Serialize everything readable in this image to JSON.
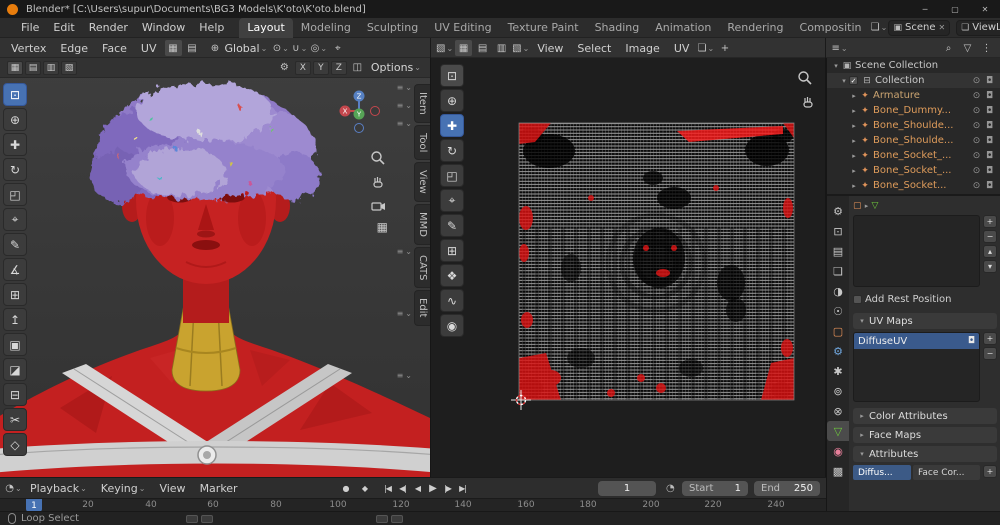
{
  "colors": {
    "accent": "#4772b3",
    "object_orange": "#e0935a",
    "data_green": "#6ec93c"
  },
  "titlebar": {
    "title": "Blender* [C:\\Users\\supur\\Documents\\BG3 Models\\K'oto\\K'oto.blend]"
  },
  "menubar": {
    "menus": [
      "File",
      "Edit",
      "Render",
      "Window",
      "Help"
    ],
    "workspaces": [
      "Layout",
      "Modeling",
      "Sculpting",
      "UV Editing",
      "Texture Paint",
      "Shading",
      "Animation",
      "Rendering",
      "Compositin"
    ],
    "scene_label": "Scene",
    "viewlayer_label": "ViewLayer"
  },
  "header3d": {
    "menus": [
      "Vertex",
      "Edge",
      "Face",
      "UV"
    ],
    "orientation": "Global",
    "mirror": [
      "X",
      "Y",
      "Z"
    ],
    "options_label": "Options"
  },
  "uv_header": {
    "menus": [
      "View",
      "Select",
      "Image",
      "UV"
    ]
  },
  "sidebar_tabs": [
    "Item",
    "Tool",
    "View",
    "MMD",
    "CATS",
    "Edit"
  ],
  "outliner": {
    "scene_collection": "Scene Collection",
    "collection": "Collection",
    "items": [
      "Armature",
      "Bone_Dummy...",
      "Bone_Shoulde...",
      "Bone_Shoulde...",
      "Bone_Socket_...",
      "Bone_Socket_...",
      "Bone_Socket..."
    ]
  },
  "properties": {
    "add_rest_position": "Add Rest Position",
    "uv_maps": "UV Maps",
    "uv_map_name": "DiffuseUV",
    "color_attributes": "Color Attributes",
    "face_maps": "Face Maps",
    "attributes": "Attributes",
    "attr_name": "Diffus...",
    "attr_domain": "Face Cor..."
  },
  "timeline": {
    "menus": [
      "Playback",
      "Keying",
      "View",
      "Marker"
    ],
    "current_frame": "1",
    "start_label": "Start",
    "start_value": "1",
    "end_label": "End",
    "end_value": "250",
    "ticks": [
      "20",
      "40",
      "60",
      "80",
      "100",
      "120",
      "140",
      "160",
      "180",
      "200",
      "220",
      "240"
    ]
  },
  "statusbar": {
    "left": "Loop Select"
  },
  "icons": {
    "minimize": "─",
    "maximize": "▢",
    "close": "✕",
    "chev": "⌄",
    "tri_r": "▸",
    "tri_d": "▾",
    "check": "✓",
    "plus": "+",
    "minus": "−",
    "up": "▴",
    "down": "▾",
    "menu": "≡",
    "search": "⌕",
    "filter": "▽",
    "dots": "⋮",
    "eye": "⊙",
    "camera": "◘",
    "collection": "⊟",
    "armature": "✦",
    "bone": "✦",
    "scene_box": "▣",
    "viewlayer_box": "❏",
    "globe": "⊕",
    "pivot": "⊙",
    "magnet": "∪",
    "proportional": "◎",
    "snap": "⌖",
    "mirror_icon": "◫",
    "grid": "▦",
    "selmode_v": "▦",
    "selmode_e": "▤",
    "selmode_f": "▥",
    "selmode_i": "▧",
    "tool_select": "⊡",
    "tool_cursor": "⊕",
    "tool_move": "✚",
    "tool_rotate": "↻",
    "tool_scale": "◰",
    "tool_transform": "⌖",
    "tool_annotate": "✎",
    "tool_measure": "∡",
    "tool_addcube": "⊞",
    "tool_extrude": "↥",
    "tool_inset": "▣",
    "tool_bevel": "◪",
    "tool_loopcut": "⊟",
    "tool_knife": "✂",
    "tool_poly": "◇",
    "tool_grab": "❖",
    "tool_relax": "∿",
    "tool_pinch": "◉",
    "ptab_tool": "⚙",
    "ptab_render": "⊡",
    "ptab_output": "▤",
    "ptab_viewlayer": "❏",
    "ptab_scene": "◑",
    "ptab_world": "☉",
    "ptab_object": "▢",
    "ptab_modifier": "⚙",
    "ptab_particles": "✱",
    "ptab_physics": "⊚",
    "ptab_constraint": "⊗",
    "ptab_data": "▽",
    "ptab_material": "◉",
    "ptab_texture": "▩",
    "clock": "◔",
    "autokey_dot": "●",
    "keyset": "◆",
    "jump_start": "|◀",
    "prev_key": "◀|",
    "play_rev": "◀",
    "play": "▶",
    "next_key": "|▶",
    "jump_end": "▶|",
    "wrench": "⚙"
  }
}
